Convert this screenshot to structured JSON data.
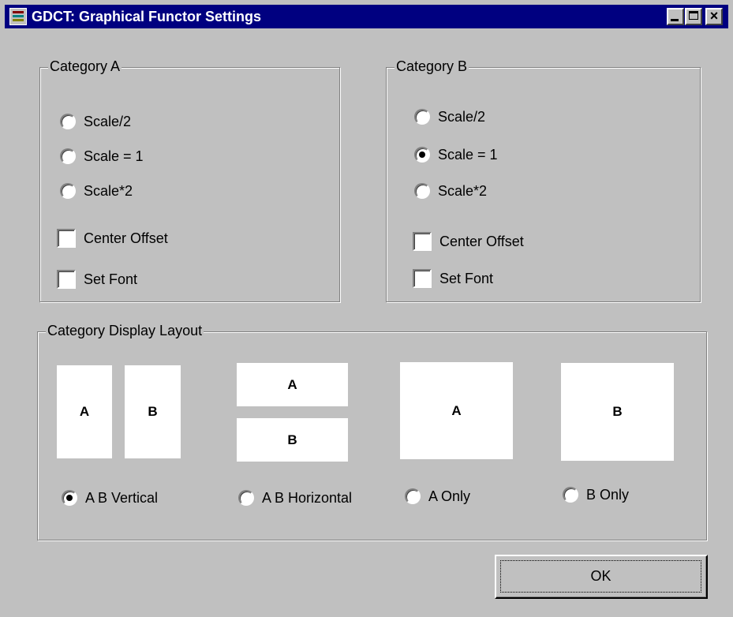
{
  "window": {
    "title": "GDCT: Graphical Functor Settings",
    "icon": "java-cup-icon",
    "colors": {
      "titlebar": "#000080",
      "face": "#c0c0c0"
    }
  },
  "category_a": {
    "label": "Category A",
    "options": [
      {
        "label": "Scale/2",
        "checked": false
      },
      {
        "label": "Scale = 1",
        "checked": false
      },
      {
        "label": "Scale*2",
        "checked": false
      }
    ],
    "center_offset": {
      "label": "Center Offset",
      "checked": false
    },
    "set_font": {
      "label": "Set Font",
      "checked": false
    }
  },
  "category_b": {
    "label": "Category B",
    "options": [
      {
        "label": "Scale/2",
        "checked": false
      },
      {
        "label": "Scale = 1",
        "checked": true
      },
      {
        "label": "Scale*2",
        "checked": false
      }
    ],
    "center_offset": {
      "label": "Center Offset",
      "checked": false
    },
    "set_font": {
      "label": "Set Font",
      "checked": false
    }
  },
  "layout": {
    "label": "Category Display Layout",
    "previews": {
      "vertical": [
        "A",
        "B"
      ],
      "horizontal": [
        "A",
        "B"
      ],
      "a_only": "A",
      "b_only": "B"
    },
    "options": [
      {
        "label": "A B Vertical",
        "checked": true
      },
      {
        "label": "A B Horizontal",
        "checked": false
      },
      {
        "label": "A Only",
        "checked": false
      },
      {
        "label": "B Only",
        "checked": false
      }
    ]
  },
  "ok_label": "OK"
}
